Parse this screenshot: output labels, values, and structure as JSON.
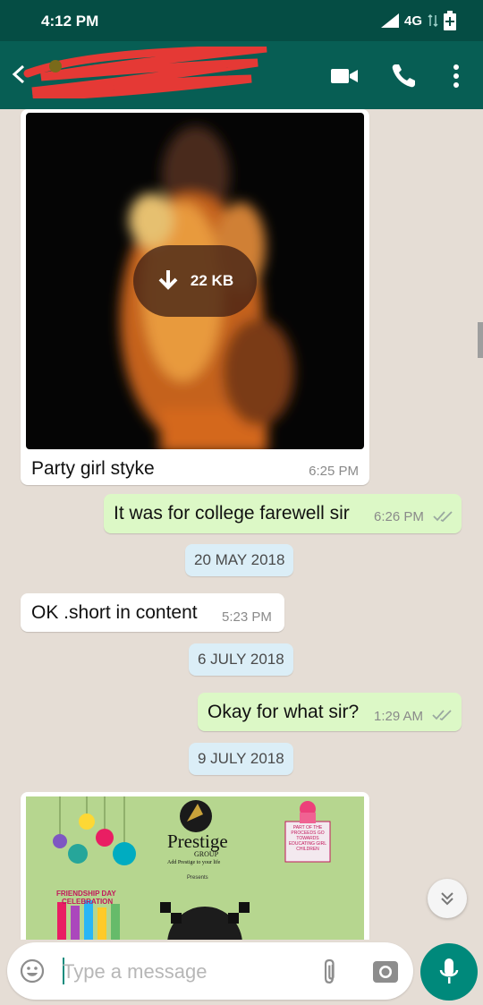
{
  "status_bar": {
    "time": "4:12 PM",
    "network": "4G"
  },
  "app_bar": {
    "contact_name_redacted": true
  },
  "messages": [
    {
      "type": "image",
      "direction": "in",
      "download_size": "22 KB",
      "caption": "Party girl styke",
      "time": "6:25 PM"
    },
    {
      "type": "text",
      "direction": "out",
      "text": "It was for college farewell sir",
      "time": "6:26 PM",
      "status": "read"
    },
    {
      "type": "date",
      "text": "20 MAY 2018"
    },
    {
      "type": "text",
      "direction": "in",
      "text": "OK .short in content",
      "time": "5:23 PM"
    },
    {
      "type": "date",
      "text": "6 JULY 2018"
    },
    {
      "type": "text",
      "direction": "out",
      "text": "Okay for what sir?",
      "time": "1:29 AM",
      "status": "read"
    },
    {
      "type": "date",
      "text": "9 JULY 2018"
    },
    {
      "type": "image",
      "direction": "in",
      "poster": {
        "brand": "Prestige",
        "brand_sub": "GROUP",
        "tagline": "Add Prestige to your life",
        "presents": "Presents",
        "badge": "PART OF THE PROCEEDS GO TOWARDS EDUCATING GIRL CHILDREN",
        "event_line1": "FRIENDSHIP DAY",
        "event_line2": "CELEBRATION"
      }
    }
  ],
  "composer": {
    "placeholder": "Type a message"
  },
  "colors": {
    "header": "#075e54",
    "status_bar": "#054d44",
    "outgoing_bubble": "#dcf8c6",
    "incoming_bubble": "#ffffff",
    "background": "#e5ddd5",
    "accent": "#00897b",
    "tick": "#9aa8a0"
  }
}
